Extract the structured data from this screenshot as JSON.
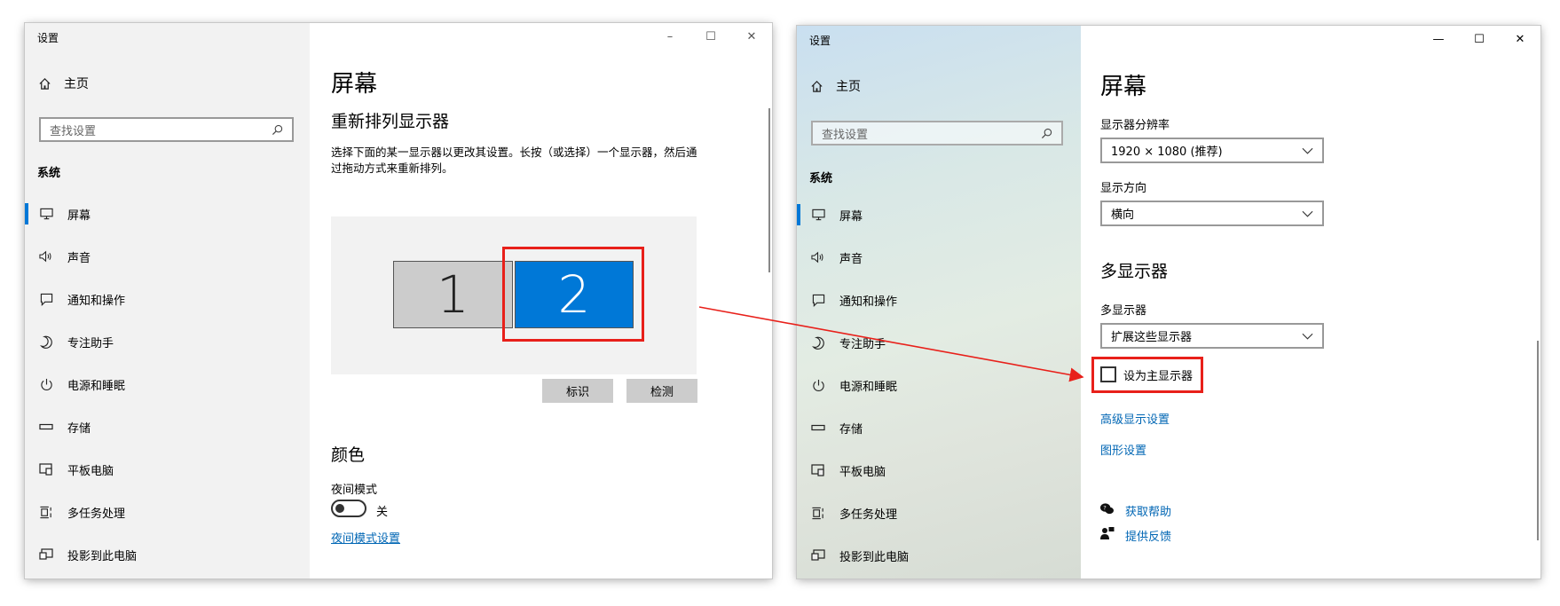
{
  "left_window": {
    "title": "设置",
    "controls": {
      "minimize": "–",
      "maximize": "☐",
      "close": "✕"
    },
    "home_label": "主页",
    "search_placeholder": "查找设置",
    "group_label": "系统",
    "nav_items": [
      {
        "label": "屏幕",
        "icon": "display-icon",
        "active": true
      },
      {
        "label": "声音",
        "icon": "speaker-icon",
        "active": false
      },
      {
        "label": "通知和操作",
        "icon": "notification-icon",
        "active": false
      },
      {
        "label": "专注助手",
        "icon": "moon-icon",
        "active": false
      },
      {
        "label": "电源和睡眠",
        "icon": "power-icon",
        "active": false
      },
      {
        "label": "存储",
        "icon": "storage-icon",
        "active": false
      },
      {
        "label": "平板电脑",
        "icon": "tablet-icon",
        "active": false
      },
      {
        "label": "多任务处理",
        "icon": "multitask-icon",
        "active": false
      },
      {
        "label": "投影到此电脑",
        "icon": "project-icon",
        "active": false
      }
    ],
    "page_title": "屏幕",
    "section_title": "重新排列显示器",
    "description": "选择下面的某一显示器以更改其设置。长按（或选择）一个显示器，然后通过拖动方式来重新排列。",
    "monitors": [
      "1",
      "2"
    ],
    "identify_button": "标识",
    "detect_button": "检测",
    "color_title": "颜色",
    "night_mode_label": "夜间模式",
    "night_mode_state": "关",
    "night_mode_link": "夜间模式设置"
  },
  "right_window": {
    "title": "设置",
    "controls": {
      "minimize": "—",
      "maximize": "☐",
      "close": "✕"
    },
    "home_label": "主页",
    "search_placeholder": "查找设置",
    "group_label": "系统",
    "nav_items": [
      {
        "label": "屏幕",
        "icon": "display-icon",
        "active": true
      },
      {
        "label": "声音",
        "icon": "speaker-icon",
        "active": false
      },
      {
        "label": "通知和操作",
        "icon": "notification-icon",
        "active": false
      },
      {
        "label": "专注助手",
        "icon": "moon-icon",
        "active": false
      },
      {
        "label": "电源和睡眠",
        "icon": "power-icon",
        "active": false
      },
      {
        "label": "存储",
        "icon": "storage-icon",
        "active": false
      },
      {
        "label": "平板电脑",
        "icon": "tablet-icon",
        "active": false
      },
      {
        "label": "多任务处理",
        "icon": "multitask-icon",
        "active": false
      },
      {
        "label": "投影到此电脑",
        "icon": "project-icon",
        "active": false
      }
    ],
    "page_title": "屏幕",
    "resolution_label": "显示器分辨率",
    "resolution_value": "1920 × 1080 (推荐)",
    "orientation_label": "显示方向",
    "orientation_value": "横向",
    "multi_title": "多显示器",
    "multi_label": "多显示器",
    "multi_value": "扩展这些显示器",
    "primary_checkbox_label": "设为主显示器",
    "primary_checked": false,
    "advanced_link": "高级显示设置",
    "graphics_link": "图形设置",
    "help_link": "获取帮助",
    "feedback_link": "提供反馈"
  },
  "colors": {
    "accent": "#0078d7",
    "highlight": "#e8201a",
    "link": "#0066b4"
  }
}
